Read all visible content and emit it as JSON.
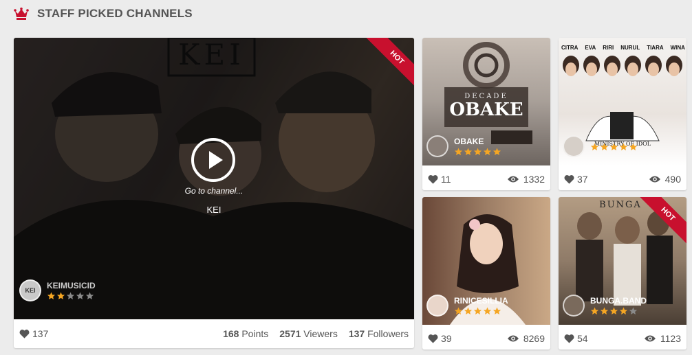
{
  "header": {
    "title": "STAFF PICKED CHANNELS",
    "icon": "crown-icon",
    "icon_color": "#c8102e"
  },
  "featured": {
    "hot_label": "HOT",
    "go_to_channel": "Go to channel...",
    "channel_name": "KEI",
    "owner": "KEIMUSICID",
    "avatar_text": "KEI",
    "rating": 2,
    "likes": "137",
    "points_value": "168",
    "points_label": "Points",
    "viewers_value": "2571",
    "viewers_label": "Viewers",
    "followers_value": "137",
    "followers_label": "Followers",
    "logo_text": "KEI"
  },
  "channels": [
    {
      "owner": "OBAKE",
      "rating": 5,
      "likes": "11",
      "views": "1332",
      "hot": false,
      "poster_title": "OBAKE",
      "poster_sub": "DECADE"
    },
    {
      "owner": "",
      "rating": 5,
      "likes": "37",
      "views": "490",
      "hot": false,
      "poster_title": "MINISTRY OF IDOL",
      "names": [
        "CITRA",
        "EVA",
        "RIRI",
        "NURUL",
        "TIARA",
        "WINA"
      ]
    },
    {
      "owner": "RINICESILLIA",
      "rating": 5,
      "likes": "39",
      "views": "8269",
      "hot": false
    },
    {
      "owner": "BUNGA.BAND",
      "rating": 4,
      "likes": "54",
      "views": "1123",
      "hot": true,
      "hot_label": "HOT",
      "poster_title": "BUNGA"
    }
  ],
  "colors": {
    "star_on": "#f5a623",
    "star_off": "#8a8a8a",
    "ribbon": "#c8102e"
  }
}
